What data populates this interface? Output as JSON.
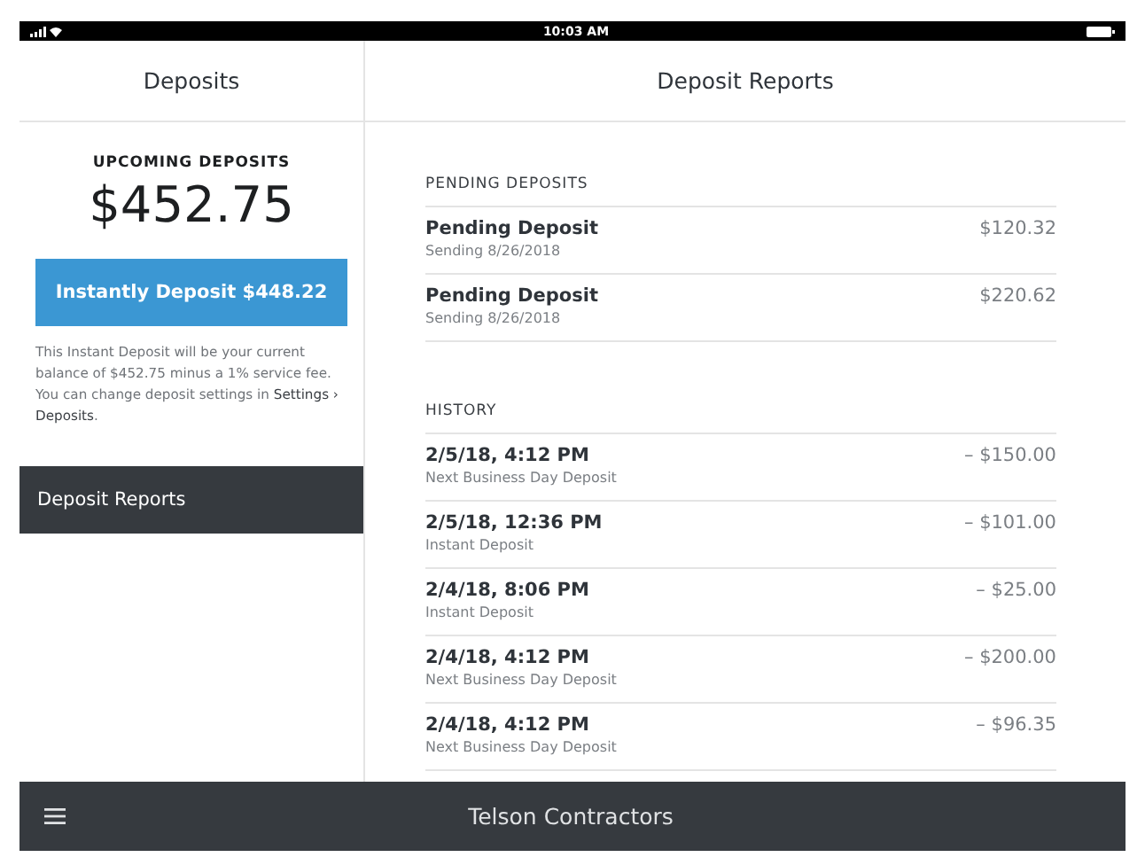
{
  "status_bar": {
    "time": "10:03 AM"
  },
  "left_header": {
    "title": "Deposits"
  },
  "right_header": {
    "title": "Deposit Reports"
  },
  "upcoming": {
    "label": "UPCOMING DEPOSITS",
    "amount": "$452.75",
    "button": "Instantly Deposit $448.22",
    "note": "This Instant Deposit will be your current balance of $452.75 minus a 1% service fee. You can change deposit settings in **Settings › Deposits**."
  },
  "sidebar": {
    "items": [
      {
        "label": "Deposit Reports",
        "selected": true
      }
    ]
  },
  "sections": [
    {
      "title": "PENDING DEPOSITS",
      "rows": [
        {
          "title": "Pending Deposit",
          "subtitle": "Sending 8/26/2018",
          "amount": "$120.32"
        },
        {
          "title": "Pending Deposit",
          "subtitle": "Sending 8/26/2018",
          "amount": "$220.62"
        }
      ]
    },
    {
      "title": "HISTORY",
      "rows": [
        {
          "title": "2/5/18, 4:12 PM",
          "subtitle": "Next Business Day Deposit",
          "amount": "– $150.00"
        },
        {
          "title": "2/5/18, 12:36 PM",
          "subtitle": "Instant Deposit",
          "amount": "– $101.00"
        },
        {
          "title": "2/4/18, 8:06 PM",
          "subtitle": "Instant Deposit",
          "amount": "– $25.00"
        },
        {
          "title": "2/4/18, 4:12 PM",
          "subtitle": "Next Business Day Deposit",
          "amount": "– $200.00"
        },
        {
          "title": "2/4/18, 4:12 PM",
          "subtitle": "Next Business Day Deposit",
          "amount": "– $96.35"
        }
      ]
    }
  ],
  "bottom_bar": {
    "title": "Telson Contractors"
  }
}
